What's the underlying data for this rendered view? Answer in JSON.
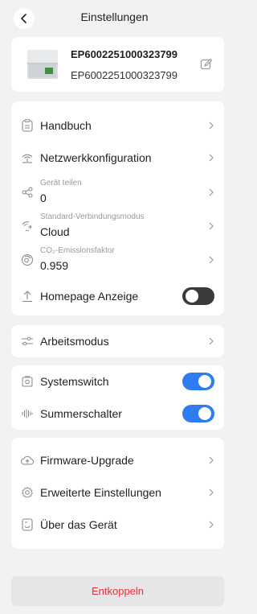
{
  "header": {
    "title": "Einstellungen"
  },
  "device": {
    "name": "EP6002251000323799",
    "serial": "EP6002251000323799"
  },
  "settings": {
    "manual": "Handbuch",
    "network": "Netzwerkkonfiguration",
    "share_label": "Gerät teilen",
    "share_value": "0",
    "conn_mode_label": "Standard-Verbindungsmodus",
    "conn_mode_value": "Cloud",
    "co2_label": "CO₂-Emissionsfaktor",
    "co2_value": "0.959",
    "homepage": "Homepage Anzeige"
  },
  "work_mode": {
    "label": "Arbeitsmodus"
  },
  "switches": {
    "system": "Systemswitch",
    "summer": "Summerschalter"
  },
  "more": {
    "firmware": "Firmware-Upgrade",
    "advanced": "Erweiterte Einstellungen",
    "about": "Über das Gerät"
  },
  "footer": {
    "unlink": "Entkoppeln"
  },
  "colors": {
    "accent": "#2f7bf0",
    "danger": "#e5303a",
    "toggle_off": "#3a3a3a"
  }
}
